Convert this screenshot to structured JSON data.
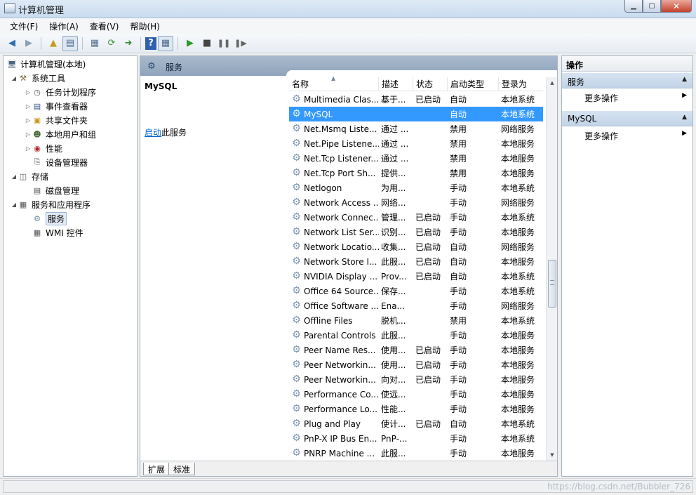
{
  "window": {
    "title": "计算机管理",
    "minimize": "▁",
    "maximize": "▢",
    "close": "✕"
  },
  "menu": [
    "文件(F)",
    "操作(A)",
    "查看(V)",
    "帮助(H)"
  ],
  "tree": {
    "root": "计算机管理(本地)",
    "system_tools": "系统工具",
    "task_scheduler": "任务计划程序",
    "event_viewer": "事件查看器",
    "shared_folders": "共享文件夹",
    "local_users": "本地用户和组",
    "performance": "性能",
    "device_manager": "设备管理器",
    "storage": "存储",
    "disk_management": "磁盘管理",
    "services_apps": "服务和应用程序",
    "services": "服务",
    "wmi": "WMI 控件"
  },
  "middle": {
    "header_title": "服务",
    "selected_service": "MySQL",
    "action_link": "启动",
    "action_suffix": "此服务",
    "columns": {
      "name": "名称",
      "desc": "描述",
      "status": "状态",
      "startup": "启动类型",
      "logon": "登录为"
    },
    "tabs": {
      "extended": "扩展",
      "standard": "标准"
    },
    "rows": [
      {
        "name": "Multimedia Clas...",
        "desc": "基于...",
        "status": "已启动",
        "startup": "自动",
        "logon": "本地系统"
      },
      {
        "name": "MySQL",
        "desc": "",
        "status": "",
        "startup": "自动",
        "logon": "本地系统"
      },
      {
        "name": "Net.Msmq Liste...",
        "desc": "通过 ...",
        "status": "",
        "startup": "禁用",
        "logon": "网络服务"
      },
      {
        "name": "Net.Pipe Listene...",
        "desc": "通过 ...",
        "status": "",
        "startup": "禁用",
        "logon": "本地服务"
      },
      {
        "name": "Net.Tcp Listener...",
        "desc": "通过 ...",
        "status": "",
        "startup": "禁用",
        "logon": "本地服务"
      },
      {
        "name": "Net.Tcp Port Sh...",
        "desc": "提供...",
        "status": "",
        "startup": "禁用",
        "logon": "本地服务"
      },
      {
        "name": "Netlogon",
        "desc": "为用...",
        "status": "",
        "startup": "手动",
        "logon": "本地系统"
      },
      {
        "name": "Network Access ...",
        "desc": "网络...",
        "status": "",
        "startup": "手动",
        "logon": "网络服务"
      },
      {
        "name": "Network Connec...",
        "desc": "管理...",
        "status": "已启动",
        "startup": "手动",
        "logon": "本地系统"
      },
      {
        "name": "Network List Ser...",
        "desc": "识别...",
        "status": "已启动",
        "startup": "手动",
        "logon": "本地服务"
      },
      {
        "name": "Network Locatio...",
        "desc": "收集...",
        "status": "已启动",
        "startup": "自动",
        "logon": "网络服务"
      },
      {
        "name": "Network Store I...",
        "desc": "此服...",
        "status": "已启动",
        "startup": "自动",
        "logon": "本地服务"
      },
      {
        "name": "NVIDIA Display ...",
        "desc": "Prov...",
        "status": "已启动",
        "startup": "自动",
        "logon": "本地系统"
      },
      {
        "name": "Office 64 Source...",
        "desc": "保存...",
        "status": "",
        "startup": "手动",
        "logon": "本地系统"
      },
      {
        "name": "Office Software ...",
        "desc": "Ena...",
        "status": "",
        "startup": "手动",
        "logon": "网络服务"
      },
      {
        "name": "Offline Files",
        "desc": "脱机...",
        "status": "",
        "startup": "禁用",
        "logon": "本地系统"
      },
      {
        "name": "Parental Controls",
        "desc": "此服...",
        "status": "",
        "startup": "手动",
        "logon": "本地服务"
      },
      {
        "name": "Peer Name Res...",
        "desc": "使用...",
        "status": "已启动",
        "startup": "手动",
        "logon": "本地服务"
      },
      {
        "name": "Peer Networkin...",
        "desc": "使用...",
        "status": "已启动",
        "startup": "手动",
        "logon": "本地服务"
      },
      {
        "name": "Peer Networkin...",
        "desc": "向对...",
        "status": "已启动",
        "startup": "手动",
        "logon": "本地服务"
      },
      {
        "name": "Performance Co...",
        "desc": "使远...",
        "status": "",
        "startup": "手动",
        "logon": "本地服务"
      },
      {
        "name": "Performance Lo...",
        "desc": "性能...",
        "status": "",
        "startup": "手动",
        "logon": "本地服务"
      },
      {
        "name": "Plug and Play",
        "desc": "使计...",
        "status": "已启动",
        "startup": "自动",
        "logon": "本地系统"
      },
      {
        "name": "PnP-X IP Bus En...",
        "desc": "PnP-...",
        "status": "",
        "startup": "手动",
        "logon": "本地系统"
      },
      {
        "name": "PNRP Machine ...",
        "desc": "此服...",
        "status": "",
        "startup": "手动",
        "logon": "本地服务"
      }
    ]
  },
  "actions": {
    "header": "操作",
    "group1": "服务",
    "group1_item": "更多操作",
    "group2": "MySQL",
    "group2_item": "更多操作"
  },
  "statusbar": {
    "watermark": "https://blog.csdn.net/Bubbler_726"
  }
}
